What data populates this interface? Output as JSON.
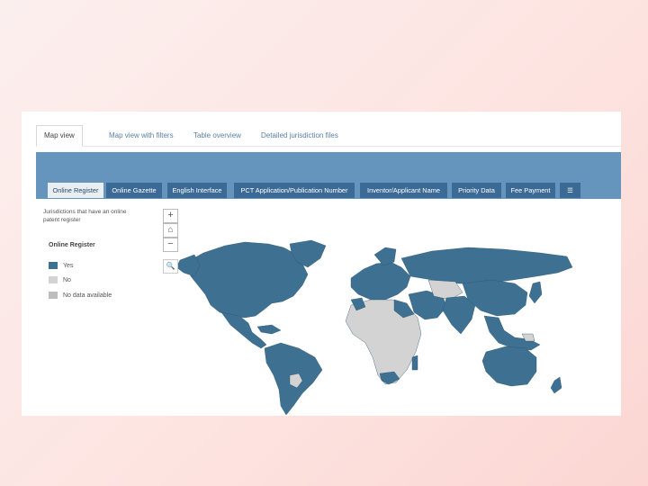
{
  "colors": {
    "register_yes": "#3e7092",
    "register_no": "#d3d3d3",
    "no_data": "#bdbdbd",
    "band": "#6595bd",
    "tab_dark": "#3a6a95"
  },
  "top_tabs": [
    {
      "label": "Map view",
      "active": true
    },
    {
      "label": "Map view with filters"
    },
    {
      "label": "Table overview"
    },
    {
      "label": "Detailed jurisdiction files"
    }
  ],
  "sub_tabs": [
    {
      "label": "Online Register",
      "active": true
    },
    {
      "label": "Online Gazette"
    },
    {
      "label": "English Interface"
    },
    {
      "label": "PCT Application/Publication Number"
    },
    {
      "label": "Inventor/Applicant Name"
    },
    {
      "label": "Priority Data"
    },
    {
      "label": "Fee Payment"
    },
    {
      "label": "☰",
      "icon": "list-icon"
    }
  ],
  "map": {
    "caption": "Jurisdictions that have an online patent register",
    "legend_title": "Online Register",
    "legend": [
      {
        "label": "Yes"
      },
      {
        "label": "No"
      },
      {
        "label": "No data available"
      }
    ],
    "controls": {
      "zoom_in": "+",
      "home": "⌂",
      "zoom_out": "−",
      "search": "🔍"
    }
  }
}
